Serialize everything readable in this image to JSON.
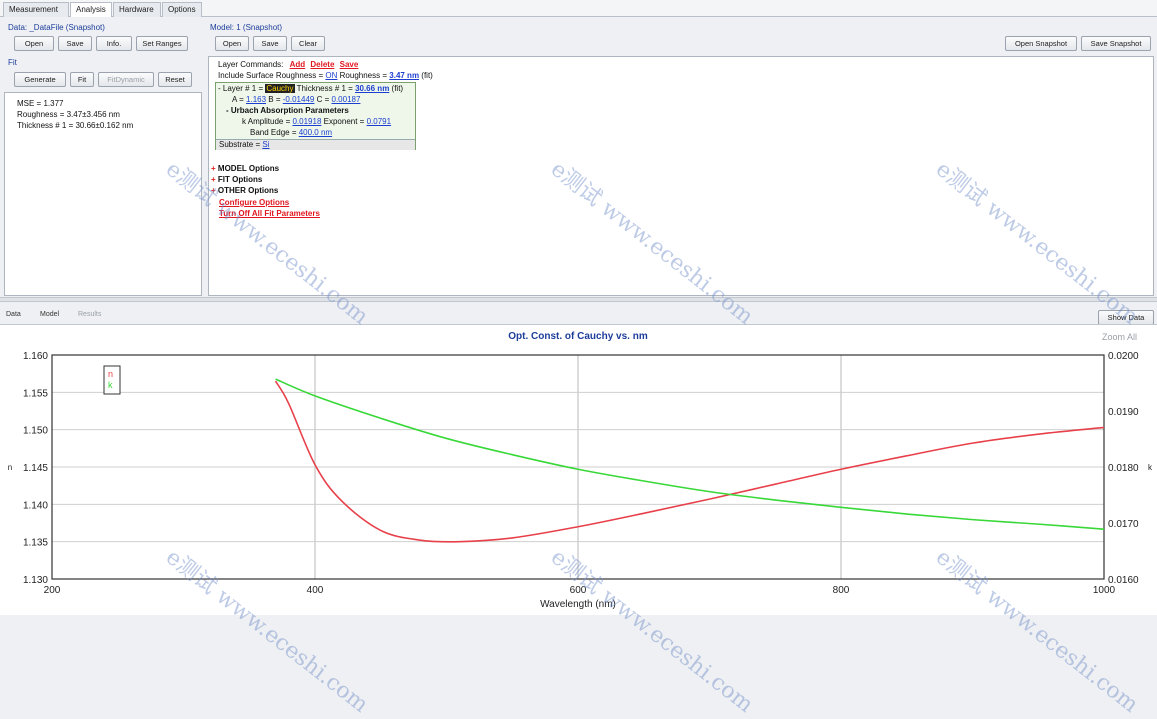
{
  "tabs": [
    {
      "label": "Measurement",
      "active": false
    },
    {
      "label": "Analysis",
      "active": true
    },
    {
      "label": "Hardware",
      "active": false
    },
    {
      "label": "Options",
      "active": false
    }
  ],
  "data_panel": {
    "title": "Data: _DataFile (Snapshot)",
    "buttons": {
      "open": "Open",
      "save": "Save",
      "info": "Info.",
      "set_ranges": "Set Ranges"
    },
    "fit_title": "Fit",
    "fit_buttons": {
      "generate": "Generate",
      "fit": "Fit",
      "fit_dynamic": "FitDynamic",
      "reset": "Reset"
    },
    "results": [
      "MSE = 1.377",
      "Roughness = 3.47±3.456 nm",
      "Thickness # 1 = 30.66±0.162 nm"
    ]
  },
  "model_panel": {
    "title": "Model: 1 (Snapshot)",
    "buttons": {
      "open": "Open",
      "save": "Save",
      "clear": "Clear"
    },
    "right_buttons": {
      "open_snapshot": "Open Snapshot",
      "save_snapshot": "Save Snapshot"
    },
    "layer_commands_label": "Layer Commands:",
    "layer_cmds": {
      "add": "Add",
      "delete": "Delete",
      "save": "Save"
    },
    "roughness_line": {
      "prefix": "Include Surface Roughness =",
      "on": "ON",
      "roughness_label": "Roughness =",
      "roughness_value": "3.47 nm",
      "suffix": "(fit)"
    },
    "layer1": {
      "prefix": "- Layer # 1 =",
      "material": "Cauchy",
      "thickness_label": "Thickness # 1 =",
      "thickness_value": "30.66 nm",
      "suffix": "(fit)",
      "a_label": "A =",
      "a_value": "1.163",
      "b_label": "B =",
      "b_value": "-0.01449",
      "c_label": "C =",
      "c_value": "0.00187",
      "urbach_title": "- Urbach Absorption Parameters",
      "k_amp_label": "k Amplitude =",
      "k_amp_value": "0.01918",
      "exponent_label": "Exponent =",
      "exponent_value": "0.0791",
      "band_edge_label": "Band Edge =",
      "band_edge_value": "400.0 nm"
    },
    "substrate": {
      "label": "Substrate =",
      "value": "Si"
    },
    "options": [
      "MODEL Options",
      "FIT Options",
      "OTHER Options"
    ],
    "links": [
      "Configure Options",
      "Turn Off All Fit Parameters"
    ]
  },
  "graph_tabs": {
    "data": "Data",
    "model": "Model",
    "results": "Results"
  },
  "graph_buttons": {
    "show_data": "Show Data",
    "zoom_all": "Zoom All"
  },
  "colors": {
    "n": "#e8404a",
    "k": "#38d838",
    "accent": "#1d3d9b"
  },
  "watermark": "e测试 www.eceshi.com",
  "chart_data": {
    "type": "line",
    "title": "Opt. Const. of Cauchy vs. nm",
    "xlabel": "Wavelength (nm)",
    "ylabel_left": "n",
    "ylabel_right": "k",
    "xlim": [
      200,
      1000
    ],
    "ylim_left": [
      1.13,
      1.16
    ],
    "ylim_right": [
      0.016,
      0.02
    ],
    "xticks": [
      "200",
      "400",
      "600",
      "800",
      "1000"
    ],
    "yticks_left": [
      "1.160",
      "1.155",
      "1.150",
      "1.145",
      "1.140",
      "1.135",
      "1.130"
    ],
    "yticks_right": [
      "0.0200",
      "0.0190",
      "0.0180",
      "0.0170",
      "0.0160"
    ],
    "grid": true,
    "legend": "top-left",
    "series": [
      {
        "name": "n",
        "axis": "left",
        "x": [
          370,
          380,
          400,
          420,
          450,
          480,
          510,
          550,
          600,
          650,
          700,
          750,
          800,
          850,
          900,
          950,
          1000
        ],
        "y": [
          1.1565,
          1.1535,
          1.1453,
          1.1405,
          1.1365,
          1.1352,
          1.135,
          1.1355,
          1.137,
          1.1388,
          1.1407,
          1.1427,
          1.1447,
          1.1465,
          1.1482,
          1.1494,
          1.1503
        ]
      },
      {
        "name": "k",
        "axis": "right",
        "x": [
          370,
          400,
          450,
          500,
          550,
          600,
          650,
          700,
          750,
          800,
          850,
          900,
          950,
          1000
        ],
        "y": [
          0.01957,
          0.01927,
          0.01887,
          0.01851,
          0.01822,
          0.01796,
          0.01775,
          0.01756,
          0.01741,
          0.01728,
          0.01716,
          0.01706,
          0.01698,
          0.01689
        ]
      }
    ]
  }
}
